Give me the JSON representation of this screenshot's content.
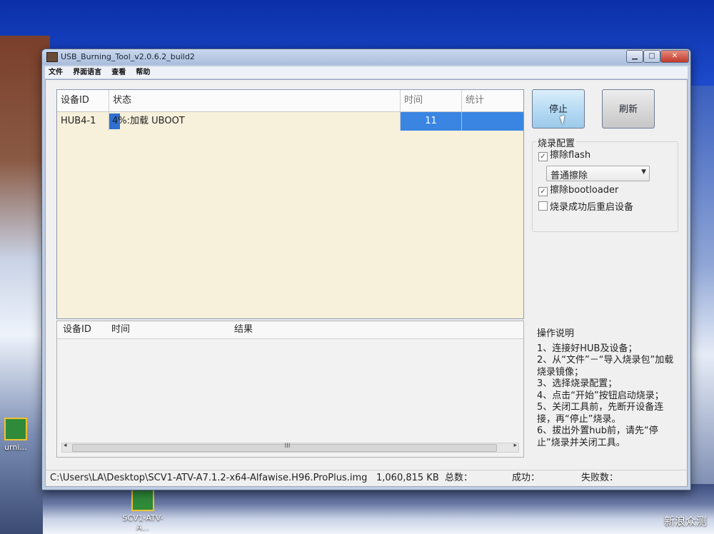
{
  "window": {
    "title": "USB_Burning_Tool_v2.0.6.2_build2"
  },
  "menu": [
    "文件",
    "界面语言",
    "查看",
    "帮助"
  ],
  "device_table": {
    "headers": [
      "设备ID",
      "状态",
      "时间",
      "统计"
    ],
    "rows": [
      {
        "id": "HUB4-1",
        "status": "4%:加载 UBOOT",
        "progress": 0.04,
        "time": "11",
        "stat": ""
      }
    ]
  },
  "log_table": {
    "headers": [
      "设备ID",
      "时间",
      "结果"
    ],
    "scroll_grip": "III"
  },
  "buttons": {
    "stop": "停止",
    "refresh": "刷新"
  },
  "config": {
    "title": "烧录配置",
    "erase_flash": {
      "label": "擦除flash",
      "checked": true
    },
    "erase_mode": "普通擦除",
    "erase_bootloader": {
      "label": "擦除bootloader",
      "checked": true
    },
    "reboot_after": {
      "label": "烧录成功后重启设备",
      "checked": false
    }
  },
  "instructions": {
    "title": "操作说明",
    "steps": [
      "1、连接好HUB及设备；",
      "2、从“文件”－“导入烧录包”加载烧录镜像；",
      "3、选择烧录配置；",
      "4、点击“开始”按钮启动烧录；",
      "5、关闭工具前，先断开设备连接，再“停止”烧录。",
      "6、拔出外置hub前，请先“停止”烧录并关闭工具。"
    ]
  },
  "statusbar": {
    "path": "C:\\Users\\LA\\Desktop\\SCV1-ATV-A7.1.2-x64-Alfawise.H96.ProPlus.img",
    "size": "1,060,815 KB",
    "total": "总数：",
    "success": "成功：",
    "fail": "失败数："
  },
  "desktop": {
    "icon_left": "urni...",
    "icon_bottom": "SCV1-ATV-A...",
    "watermark": "新浪众测"
  }
}
